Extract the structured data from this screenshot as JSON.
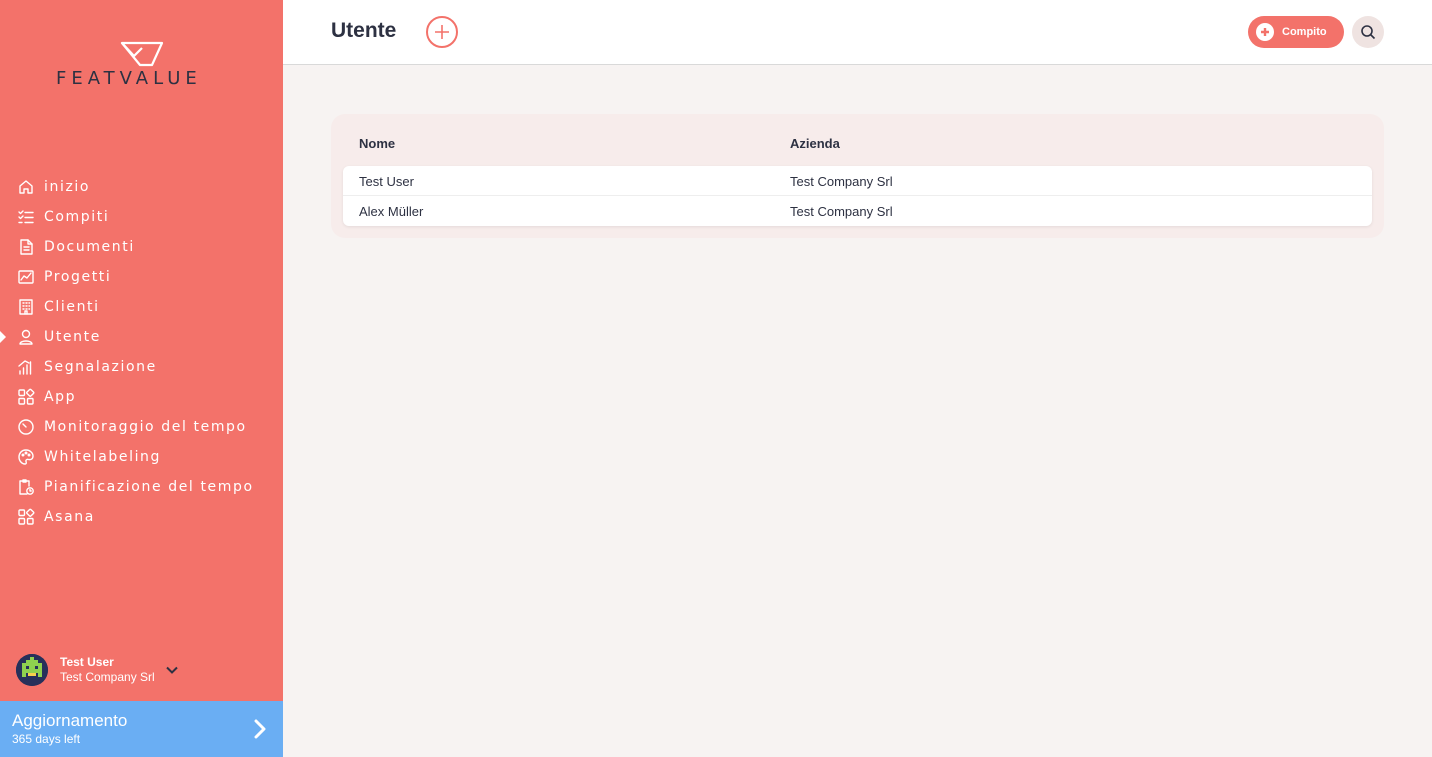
{
  "brand": {
    "name": "FEATVALUE"
  },
  "colors": {
    "sidebar": "#f3726a",
    "accent": "#f3726a",
    "upgrade": "#6aaef3",
    "text": "#2d3142"
  },
  "sidebar": {
    "items": [
      {
        "label": "inizio",
        "icon": "home-icon",
        "active": false
      },
      {
        "label": "Compiti",
        "icon": "checklist-icon",
        "active": false
      },
      {
        "label": "Documenti",
        "icon": "document-icon",
        "active": false
      },
      {
        "label": "Progetti",
        "icon": "chart-board-icon",
        "active": false
      },
      {
        "label": "Clienti",
        "icon": "building-icon",
        "active": false
      },
      {
        "label": "Utente",
        "icon": "user-icon",
        "active": true
      },
      {
        "label": "Segnalazione",
        "icon": "signal-bars-icon",
        "active": false
      },
      {
        "label": "App",
        "icon": "apps-grid-icon",
        "active": false
      },
      {
        "label": "Monitoraggio del tempo",
        "icon": "timer-icon",
        "active": false
      },
      {
        "label": "Whitelabeling",
        "icon": "palette-icon",
        "active": false
      },
      {
        "label": "Pianificazione del tempo",
        "icon": "clipboard-clock-icon",
        "active": false
      },
      {
        "label": "Asana",
        "icon": "apps-grid-icon",
        "active": false
      }
    ],
    "user": {
      "name": "Test User",
      "company": "Test Company Srl"
    },
    "upgrade": {
      "title": "Aggiornamento",
      "subtitle": "365 days left"
    }
  },
  "header": {
    "title": "Utente",
    "task_button": "Compito"
  },
  "table": {
    "columns": [
      "Nome",
      "Azienda"
    ],
    "rows": [
      [
        "Test User",
        "Test Company Srl"
      ],
      [
        "Alex Müller",
        "Test Company Srl"
      ]
    ]
  }
}
